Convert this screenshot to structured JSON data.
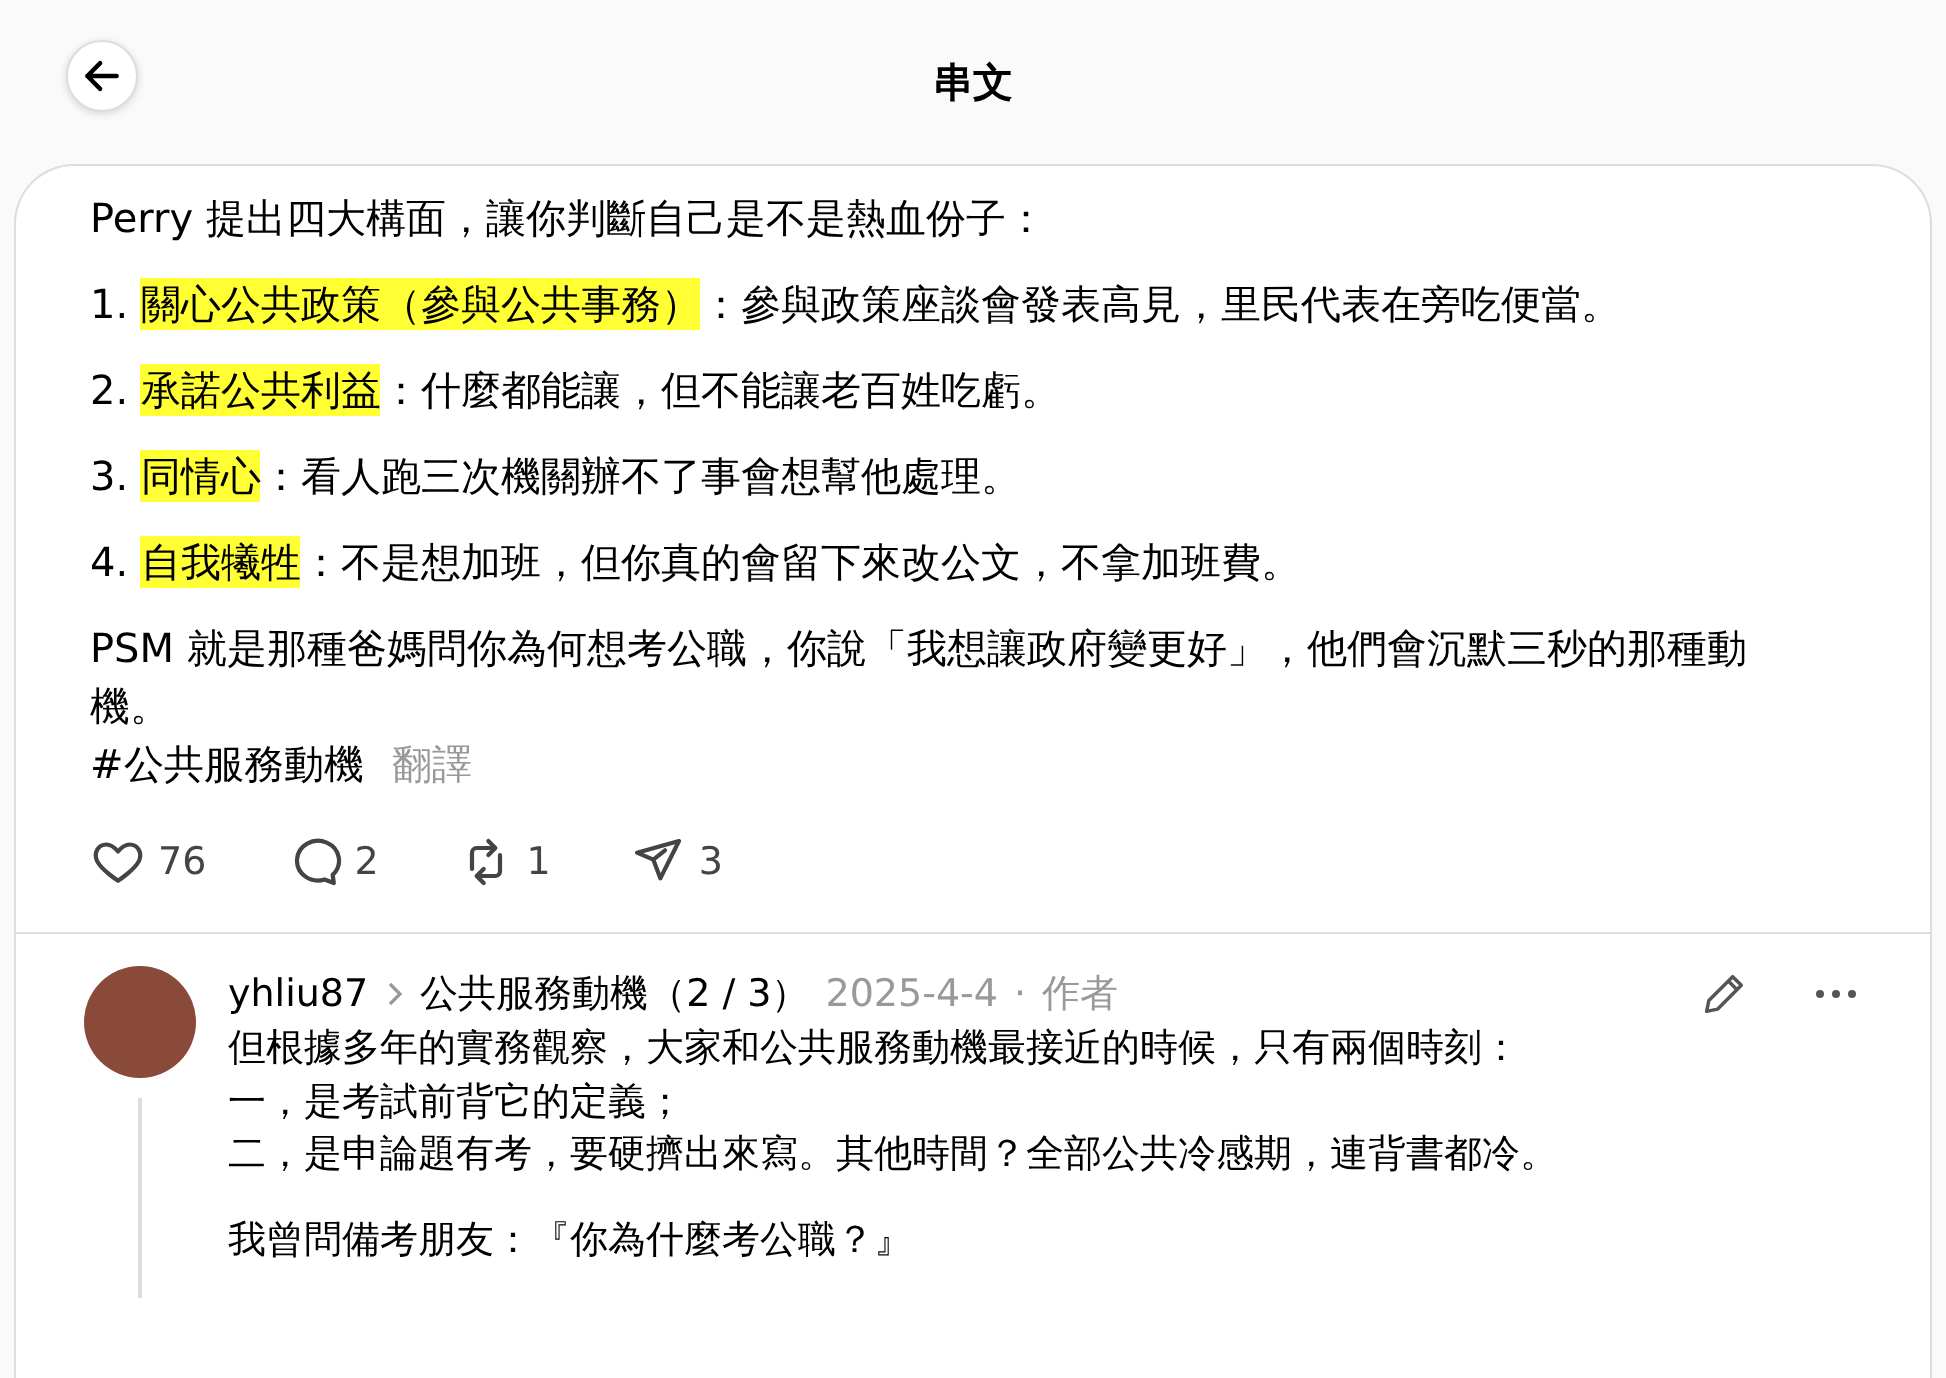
{
  "header": {
    "title": "串文"
  },
  "post": {
    "intro": "Perry 提出四大構面，讓你判斷自己是不是熱血份子：",
    "items": [
      {
        "number": "1.",
        "term": "關心公共政策（參與公共事務）",
        "highlighted": true,
        "rest": "：參與政策座談會發表高見，里民代表在旁吃便當。"
      },
      {
        "number": "2.",
        "term": "承諾公共利益",
        "highlighted": true,
        "rest": "：什麼都能讓，但不能讓老百姓吃虧。"
      },
      {
        "number": "3.",
        "term": "同情心",
        "highlighted": true,
        "rest": "：看人跑三次機關辦不了事會想幫他處理。"
      },
      {
        "number": "4.",
        "term": "自我犧牲",
        "highlighted": true,
        "rest": "：不是想加班，但你真的會留下來改公文，不拿加班費。"
      }
    ],
    "closing": "PSM 就是那種爸媽問你為何想考公職，你說「我想讓政府變更好」，他們會沉默三秒的那種動機。",
    "hashtag": "#公共服務動機",
    "translate": "翻譯",
    "actions": [
      {
        "kind": "like",
        "count": "76"
      },
      {
        "kind": "reply",
        "count": "2"
      },
      {
        "kind": "repost",
        "count": "1"
      },
      {
        "kind": "share",
        "count": "3"
      }
    ]
  },
  "reply": {
    "username": "yhliu87",
    "thread_title": "公共服務動機（2 / 3）",
    "date": "2025-4-4",
    "separator": "·",
    "role": "作者",
    "lines": [
      "但根據多年的實務觀察，大家和公共服務動機最接近的時候，只有兩個時刻：",
      "一，是考試前背它的定義；",
      "二，是申論題有考，要硬擠出來寫。其他時間？全部公共冷感期，連背書都冷。"
    ],
    "next_paragraph": "我曾問備考朋友：『你為什麼考公職？』"
  }
}
